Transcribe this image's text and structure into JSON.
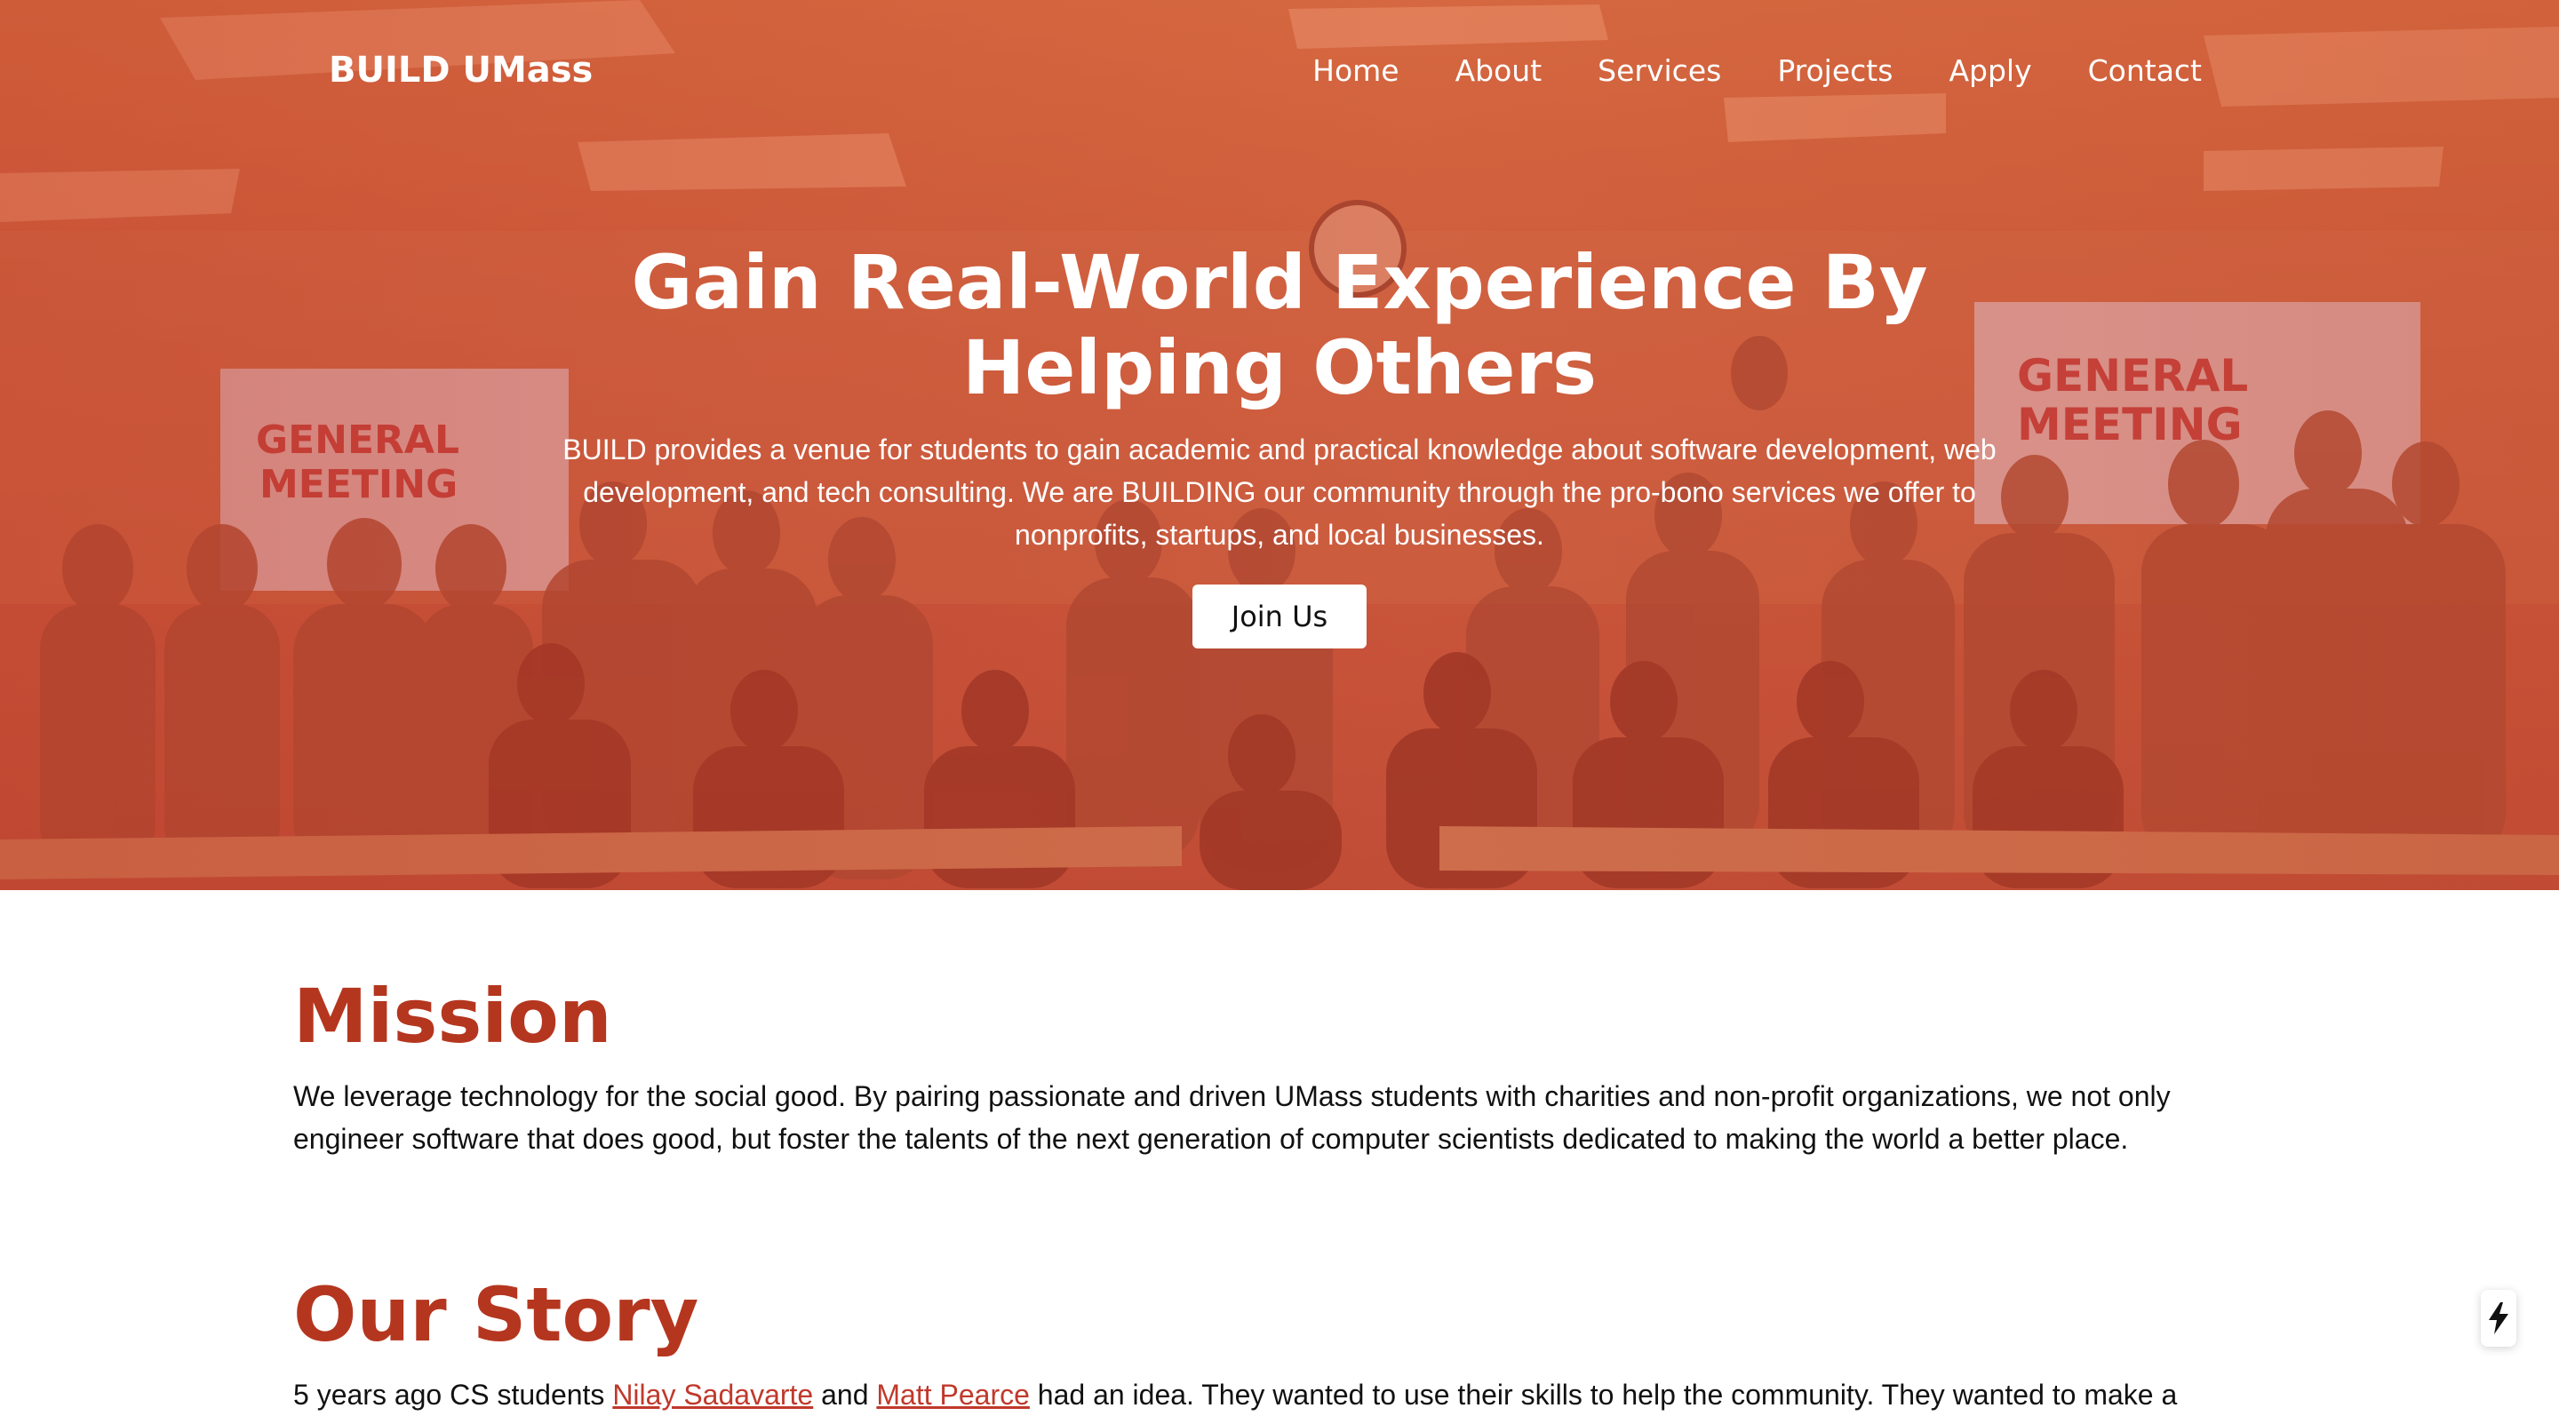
{
  "nav": {
    "brand": "BUILD UMass",
    "links": [
      "Home",
      "About",
      "Services",
      "Projects",
      "Apply",
      "Contact"
    ]
  },
  "hero": {
    "title_line1": "Gain Real-World Experience By",
    "title_line2": "Helping Others",
    "subtitle": "BUILD provides a venue for students to gain academic and practical knowledge about software development, web development, and tech consulting. We are BUILDING our community through the pro-bono services we offer to nonprofits, startups, and local businesses.",
    "cta_label": "Join Us",
    "photo_banner_text_left": "GENERAL MEETING",
    "photo_banner_text_right": "GENERAL MEETING"
  },
  "mission": {
    "title": "Mission",
    "text": "We leverage technology for the social good. By pairing passionate and driven UMass students with charities and non-profit organizations, we not only engineer software that does good, but foster the talents of the next generation of computer scientists dedicated to making the world a better place."
  },
  "story": {
    "title": "Our Story",
    "text_before": "5 years ago CS students ",
    "link1": "Nilay Sadavarte",
    "text_mid": " and ",
    "link2": "Matt Pearce",
    "text_after": " had an idea. They wanted to use their skills to help the community. They wanted to make a"
  },
  "colors": {
    "accent": "#b5361f",
    "hero_tint": "#c8553a",
    "link": "#c0392b"
  },
  "icons": {
    "floating_button": "lightning-bolt-icon"
  }
}
